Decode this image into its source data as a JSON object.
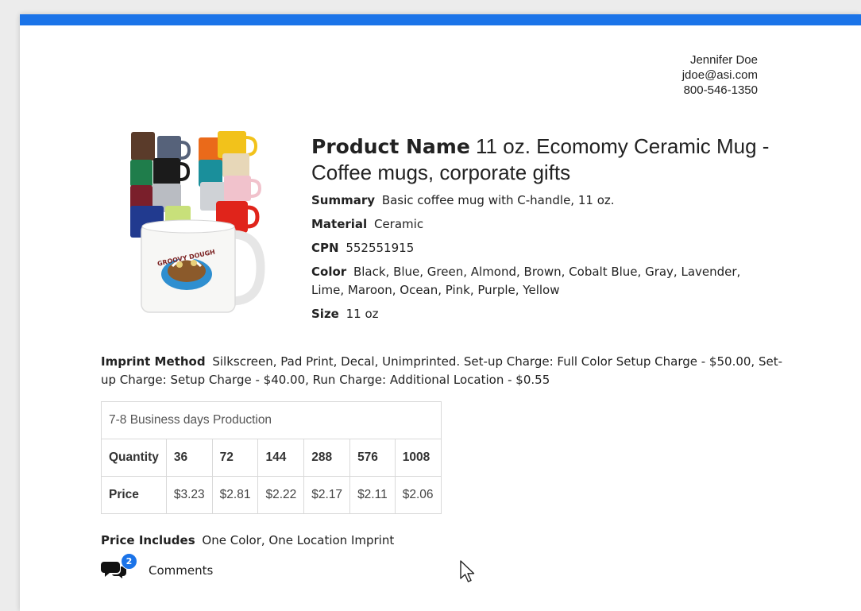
{
  "contact": {
    "name": "Jennifer Doe",
    "email": "jdoe@asi.com",
    "phone": "800-546-1350"
  },
  "product": {
    "name_label": "Product Name",
    "name_value": "11 oz. Ecomomy Ceramic Mug - Coffee mugs, corporate gifts",
    "summary_label": "Summary",
    "summary_value": "Basic coffee mug with C-handle, 11 oz.",
    "material_label": "Material",
    "material_value": "Ceramic",
    "cpn_label": "CPN",
    "cpn_value": "552551915",
    "color_label": "Color",
    "color_value": "Black, Blue, Green, Almond, Brown, Cobalt Blue, Gray, Lavender, Lime, Maroon, Ocean, Pink, Purple, Yellow",
    "size_label": "Size",
    "size_value": "11 oz",
    "image_print_text": "GROOVY DOUGH"
  },
  "imprint": {
    "label": "Imprint Method",
    "value": "Silkscreen, Pad Print, Decal, Unimprinted. Set-up Charge: Full Color Setup Charge - $50.00, Set-up Charge: Setup Charge - $40.00, Run Charge: Additional Location - $0.55"
  },
  "pricing": {
    "production": "7-8 Business days Production",
    "quantity_label": "Quantity",
    "price_label": "Price",
    "quantities": [
      "36",
      "72",
      "144",
      "288",
      "576",
      "1008"
    ],
    "prices": [
      "$3.23",
      "$2.81",
      "$2.22",
      "$2.17",
      "$2.11",
      "$2.06"
    ]
  },
  "includes": {
    "label": "Price Includes",
    "value": "One Color, One Location Imprint"
  },
  "comments": {
    "count": "2",
    "label": "Comments",
    "icon": "comments-icon"
  },
  "colors": {
    "accent": "#1a73e8",
    "background": "#ececec"
  }
}
